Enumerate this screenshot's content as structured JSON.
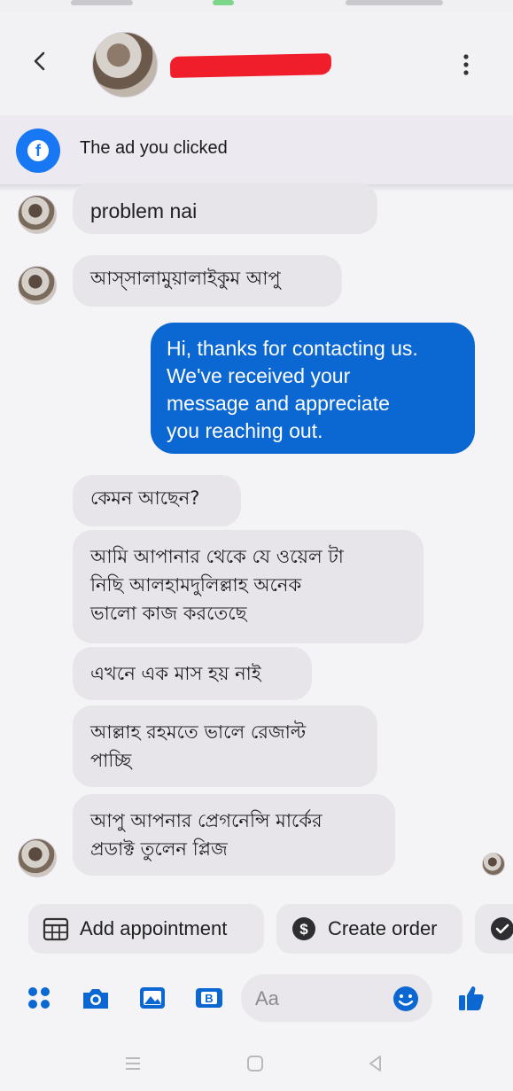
{
  "header": {
    "contact_name_redacted": "",
    "back_icon": "chevron-left-icon",
    "menu_icon": "more-vertical-icon"
  },
  "ad_banner": {
    "text": "The ad you clicked",
    "icon": "facebook-icon"
  },
  "messages": [
    {
      "direction": "in",
      "text": "problem  nai"
    },
    {
      "direction": "in",
      "text": "আস্সালামুয়ালাইকুম আপু"
    },
    {
      "direction": "out",
      "lines": [
        "Hi, thanks for contacting us.",
        "We've received your",
        "message and appreciate",
        "you reaching out."
      ]
    },
    {
      "direction": "in",
      "text": "কেমন আছেন?"
    },
    {
      "direction": "in",
      "lines": [
        "আমি  আপানার  থেকে যে ওয়েল টা",
        "নিছি আলহামদুলিল্লাহ  অনেক",
        "ভালো  কাজ করতেছে"
      ]
    },
    {
      "direction": "in",
      "text": "এখনে এক মাস হয় নাই"
    },
    {
      "direction": "in",
      "lines": [
        "আল্লাহ  রহমতে  ভালে রেজাল্ট",
        "পাচ্ছি"
      ]
    },
    {
      "direction": "in",
      "lines": [
        "আপু আপনার  প্রেগনেন্সি মার্কের",
        "প্রডাক্ট তুলেন প্লিজ"
      ]
    }
  ],
  "quick_actions": [
    {
      "label": "Add appointment",
      "icon": "calendar-icon"
    },
    {
      "label": "Create order",
      "icon": "dollar-icon"
    },
    {
      "label": "",
      "icon": "check-circle-icon"
    }
  ],
  "composer": {
    "placeholder": "Aa",
    "icons": [
      "apps-icon",
      "camera-icon",
      "image-icon",
      "currency-icon",
      "emoji-icon",
      "thumbs-up-icon"
    ]
  },
  "colors": {
    "accent": "#0b67d1",
    "incoming_bubble": "#e7e4ea",
    "redaction": "#f01d2a"
  }
}
